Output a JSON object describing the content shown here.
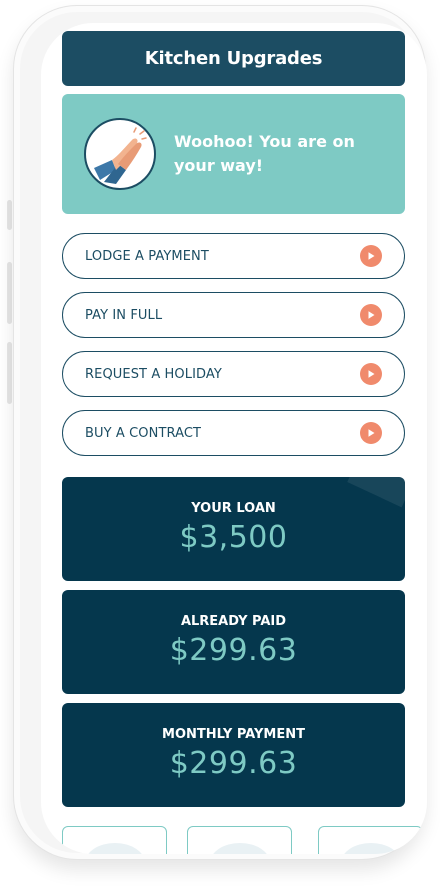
{
  "header": {
    "title": "Kitchen Upgrades"
  },
  "banner": {
    "message": "Woohoo! You are on your way!",
    "icon": "clapping-hands-icon"
  },
  "actions": [
    {
      "label": "LODGE A PAYMENT",
      "icon": "play-icon"
    },
    {
      "label": "PAY IN FULL",
      "icon": "play-icon"
    },
    {
      "label": "REQUEST A HOLIDAY",
      "icon": "play-icon"
    },
    {
      "label": "BUY A CONTRACT",
      "icon": "play-icon"
    }
  ],
  "summary": [
    {
      "label": "YOUR LOAN",
      "value": "$3,500"
    },
    {
      "label": "ALREADY PAID",
      "value": "$299.63"
    },
    {
      "label": "MONTHLY PAYMENT",
      "value": "$299.63"
    }
  ],
  "colors": {
    "title_bg": "#1c4d63",
    "banner_bg": "#7ecac4",
    "stat_bg": "#05374d",
    "accent": "#f08a6c"
  }
}
